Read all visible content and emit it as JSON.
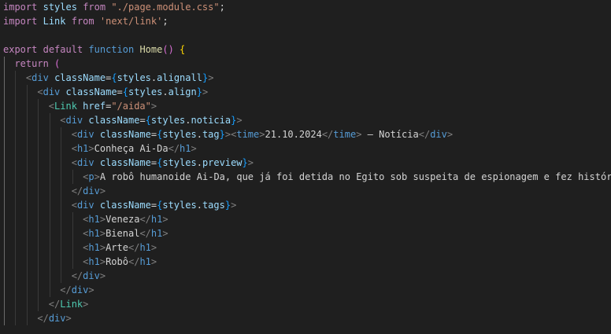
{
  "editor": {
    "language": "javascript-jsx",
    "code_lines": [
      "import styles from \"./page.module.css\";",
      "import Link from 'next/link';",
      "",
      "export default function Home() {",
      "  return (",
      "    <div className={styles.alignall}>",
      "      <div className={styles.align}>",
      "        <Link href=\"/aida\">",
      "          <div className={styles.noticia}>",
      "            <div className={styles.tag}><time>21.10.2024</time> – Notícia</div>",
      "            <h1>Conheça Ai-Da</h1>",
      "            <div className={styles.preview}>",
      "              <p>A robô humanoide Ai-Da, que já foi detida no Egito sob suspeita de espionagem e fez histór",
      "            </div>",
      "            <div className={styles.tags}>",
      "              <h1>Veneza</h1>",
      "              <h1>Bienal</h1>",
      "              <h1>Arte</h1>",
      "              <h1>Robô</h1>",
      "            </div>",
      "          </div>",
      "        </Link>",
      "      </div>"
    ],
    "colors": {
      "background": "#1f1f1f",
      "keyword": "#c586c0",
      "storage": "#569cd6",
      "variable": "#9cdcfe",
      "string": "#ce9178",
      "function": "#dcdcaa",
      "component": "#4ec9b0",
      "text": "#d4d4d4",
      "punctuation": "#808080"
    }
  }
}
